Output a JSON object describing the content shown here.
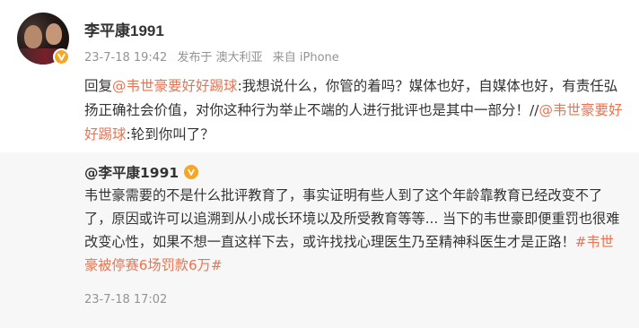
{
  "post": {
    "username": "李平康1991",
    "meta": {
      "time": "23-7-18 19:42",
      "location": "发布于 澳大利亚",
      "source": "来自 iPhone"
    },
    "content": {
      "prefix": "回复",
      "mention1": "@韦世豪要好好踢球",
      "text1": ":我想说什么，你管的着吗？媒体也好，自媒体也好，有责任弘扬正确社会价值，对你这种行为举止不端的人进行批评也是其中一部分！//",
      "mention2": "@韦世豪要好好踢球",
      "text2": ":轮到你叫了？"
    }
  },
  "repost": {
    "username": "@李平康1991",
    "text": "韦世豪需要的不是什么批评教育了，事实证明有些人到了这个年龄靠教育已经改变不了了，原因或许可以追溯到从小成长环境以及所受教育等等... 当下的韦世豪即便重罚也很难改变心性，如果不想一直这样下去，或许找找心理医生乃至精神科医生才是正路！",
    "hashtag": "#韦世豪被停赛6场罚款6万#",
    "time": "23-7-18 17:02"
  },
  "colors": {
    "mention": "#eb7350",
    "badge": "#f6a623",
    "meta_text": "#939393",
    "repost_bg": "#f7f7f7"
  },
  "icons": {
    "avatar": "user-avatar",
    "verified": "verified-badge-icon"
  }
}
